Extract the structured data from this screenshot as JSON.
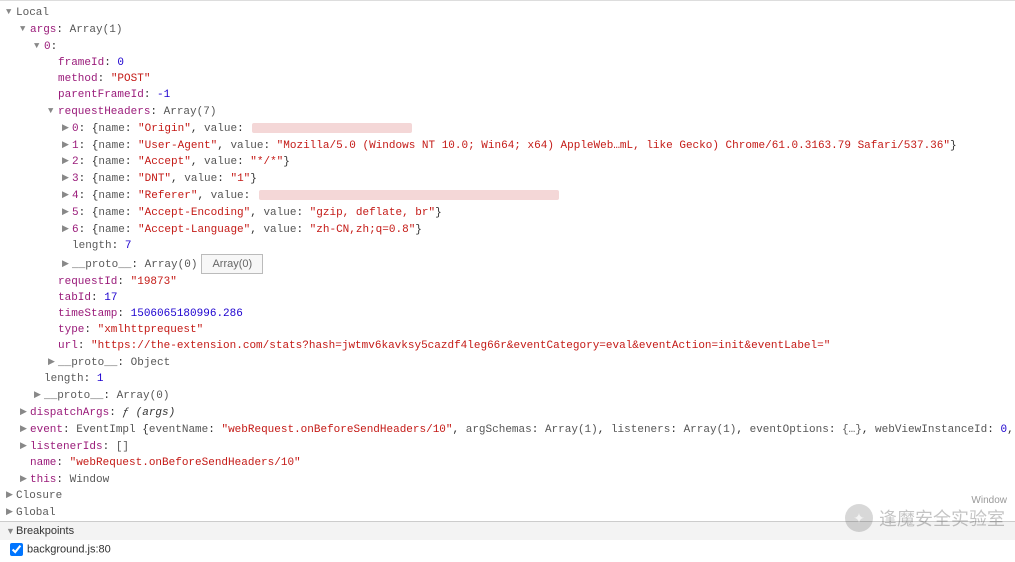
{
  "scope": {
    "local": "Local",
    "args_label": "args",
    "args_type": "Array(1)",
    "idx0": "0",
    "frameId": {
      "k": "frameId",
      "v": "0"
    },
    "method": {
      "k": "method",
      "v": "\"POST\""
    },
    "parentFrameId": {
      "k": "parentFrameId",
      "v": "-1"
    },
    "requestHeaders": {
      "k": "requestHeaders",
      "t": "Array(7)"
    },
    "hdr": [
      {
        "idx": "0",
        "name": "\"Origin\"",
        "val_hidden": true
      },
      {
        "idx": "1",
        "name": "\"User-Agent\"",
        "val": "\"Mozilla/5.0 (Windows NT 10.0; Win64; x64) AppleWeb…mL, like Gecko) Chrome/61.0.3163.79 Safari/537.36\""
      },
      {
        "idx": "2",
        "name": "\"Accept\"",
        "val": "\"*/*\""
      },
      {
        "idx": "3",
        "name": "\"DNT\"",
        "val": "\"1\""
      },
      {
        "idx": "4",
        "name": "\"Referer\"",
        "val_hidden": true,
        "wide": true
      },
      {
        "idx": "5",
        "name": "\"Accept-Encoding\"",
        "val": "\"gzip, deflate, br\""
      },
      {
        "idx": "6",
        "name": "\"Accept-Language\"",
        "val": "\"zh-CN,zh;q=0.8\""
      }
    ],
    "hdr_len": {
      "k": "length",
      "v": "7"
    },
    "hdr_proto": {
      "k": "__proto__",
      "v": "Array(0)"
    },
    "tooltip": "Array(0)",
    "requestId": {
      "k": "requestId",
      "v": "\"19873\""
    },
    "tabId": {
      "k": "tabId",
      "v": "17"
    },
    "timeStamp": {
      "k": "timeStamp",
      "v": "1506065180996.286"
    },
    "type": {
      "k": "type",
      "v": "\"xmlhttprequest\""
    },
    "url": {
      "k": "url",
      "v": "\"https://the-extension.com/stats?hash=jwtmv6kavksy5cazdf4leg66r&eventCategory=eval&eventAction=init&eventLabel=\""
    },
    "args_len": {
      "k": "length",
      "v": "1"
    },
    "args_proto": {
      "k": "__proto__",
      "v": "Array(0)"
    },
    "dispatchArgs": {
      "k": "dispatchArgs",
      "sig": "ƒ (args)"
    },
    "event": {
      "k": "event",
      "type": "EventImpl",
      "eventName": "\"webRequest.onBeforeSendHeaders/10\"",
      "argSchemas": "Array(1)",
      "listeners": "Array(1)",
      "eventOptions": "{…}",
      "webViewInstanceId": "0"
    },
    "listenerIds": {
      "k": "listenerIds",
      "v": "[]"
    },
    "name": {
      "k": "name",
      "v": "\"webRequest.onBeforeSendHeaders/10\""
    },
    "this": {
      "k": "this",
      "v": "Window"
    },
    "closure": "Closure",
    "global": "Global",
    "windowlbl": "Window"
  },
  "breakpoints": {
    "title": "Breakpoints",
    "bp0": "background.js:80"
  },
  "watermark": "逢魔安全实验室"
}
